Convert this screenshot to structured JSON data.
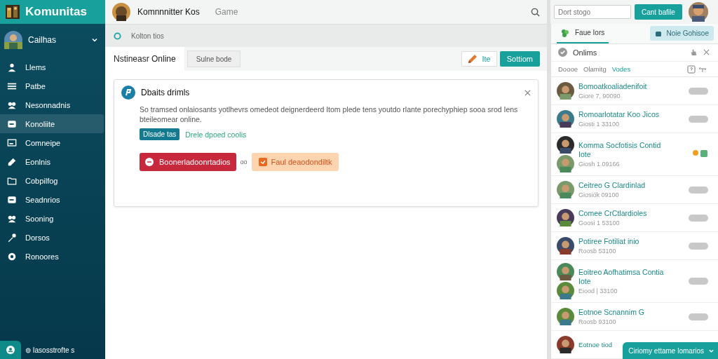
{
  "sidebar": {
    "logo": "Komunitas",
    "user": {
      "name": "Cailhas",
      "expanded": false
    },
    "items": [
      {
        "label": "Llems",
        "selected": false
      },
      {
        "label": "Patbe",
        "selected": false
      },
      {
        "label": "Nesonnadnis",
        "selected": false
      },
      {
        "label": "Konoliite",
        "selected": true
      },
      {
        "label": "Comneipe",
        "selected": false
      },
      {
        "label": "Eonlnis",
        "selected": false
      },
      {
        "label": "Cobpilfog",
        "selected": false
      },
      {
        "label": "Seadnrios",
        "selected": false
      },
      {
        "label": "Sooning",
        "selected": false
      },
      {
        "label": "Dorsos",
        "selected": false
      },
      {
        "label": "Ronoores",
        "selected": false
      }
    ],
    "footer": "⊚ Iasosstrofte s"
  },
  "topbar": {
    "title": "Komnnnitter Kos",
    "subtitle": "Game"
  },
  "breadcrumb": "Kolton tios",
  "tabs": [
    {
      "label": "Nstineasr Online",
      "selected": true
    },
    {
      "label": "Sulne bode",
      "selected": false
    }
  ],
  "actions": {
    "edit": "Ite",
    "primary": "Sottiom"
  },
  "card": {
    "title": "Dbaits drimls",
    "text": "So tramsed onlaiosants yotlhevrs omedeot deignerdeerd Itom plede tens youtdo rlante porechyphiep sooa srod Iens bteileomear online.",
    "tag": "Dlsade tas",
    "link": "Drele dpoed coolis",
    "danger": "Boonerladoonrtadios",
    "separator": "oo",
    "warning": "Faul deaodondiltk"
  },
  "right": {
    "search": {
      "placeholder": "Dort stogo"
    },
    "button": "Cant bafile",
    "tab": "Faue Iors",
    "action": "Noie Gohisoe",
    "section": "Onlims",
    "filters": [
      {
        "label": "Doooe",
        "selected": false
      },
      {
        "label": "Olamitg",
        "selected": false
      },
      {
        "label": "Vodes",
        "selected": true
      }
    ],
    "chats": [
      {
        "name": "Bomoatkoaliadenifoit",
        "sub": "Giore 7, 90090",
        "kind": "single"
      },
      {
        "name": "Romoarlotatar Koo Jicos",
        "sub": "Giosti 1 33100",
        "kind": "single"
      },
      {
        "name": "Komma Socfotisis Contid Iote",
        "sub": "Giosh 1 09166",
        "kind": "groupicons"
      },
      {
        "name": "Ceitreo G Clardinlad",
        "sub": "Giosiók 09100",
        "kind": "single"
      },
      {
        "name": "Comee CrCtlardioles",
        "sub": "Goosi 1 53100",
        "kind": "single"
      },
      {
        "name": "Potiree Fotiliat inio",
        "sub": "Roosb 53100",
        "kind": "single"
      },
      {
        "name": "Eoitreo Aofhatimsa Contia Iote",
        "sub": "Eiood | 33100",
        "kind": "group"
      },
      {
        "name": "Eotnoe Scnannim G",
        "sub": "Roosb 93100",
        "kind": "single"
      },
      {
        "name": "Eotnoe tiod",
        "kind": "partial"
      }
    ],
    "float": "Ciriomy ettame lomarios"
  }
}
